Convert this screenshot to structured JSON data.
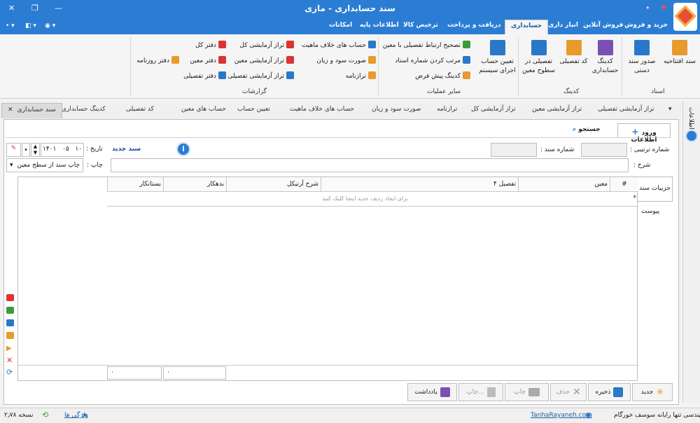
{
  "titlebar": {
    "title": "سند حسابداری - مازی"
  },
  "menu": {
    "items": [
      "خرید و فروش",
      "فروش آنلاین",
      "انبار داری",
      "حسابداری",
      "دریافت و پرداخت",
      "ترخیص کالا",
      "اطلاعات پایه",
      "امکانات"
    ],
    "active_index": 3
  },
  "ribbon": {
    "sanad_group": {
      "label": "اسناد",
      "open_doc": "سند افتتاحیه",
      "issue_manual": "صدور سند دستی"
    },
    "coding_group": {
      "label": "کدینگ",
      "coding_acc": "کدینگ حسابداری",
      "detail_code": "کد تفصیلی",
      "detail_levels": "تفصیلی در سطوح معین"
    },
    "ops_group": {
      "label": "سایر عملیات",
      "set_system_acc": "تعیین حساب اجزای سیستم",
      "fix_link": "تصحیح ارتباط تفصیلی با معین",
      "sort_numbers": "مرتب کردن شماره اسناد",
      "default_coding": "کدینگ پیش فرض"
    },
    "reports_group": {
      "label": "گزارشات",
      "wrong_nature": "حساب های خلاف ماهیت",
      "profit_loss": "صورت سود و زیان",
      "balance": "ترازنامه",
      "trial_total": "تراز آزمایشی کل",
      "trial_moin": "تراز آزمایشی معین",
      "trial_detail": "تراز آزمایشی تفصیلی",
      "ledger_total": "دفتر کل",
      "ledger_moin": "دفتر معین",
      "ledger_detail": "دفتر تفصیلی",
      "journal": "دفتر روزنامه"
    }
  },
  "tabs": [
    {
      "label": "تراز آزمایشی تفصیلی"
    },
    {
      "label": "تراز آزمایشی معین"
    },
    {
      "label": "تراز آزمایشی کل"
    },
    {
      "label": "ترازنامه"
    },
    {
      "label": "صورت سود و زیان"
    },
    {
      "label": "حساب های خلاف ماهیت"
    },
    {
      "label": "تعیین حساب"
    },
    {
      "label": "حساب های معین"
    },
    {
      "label": "کد تفصیلی"
    },
    {
      "label": "کدینگ حسابداری"
    },
    {
      "label": "سند حسابداری"
    }
  ],
  "side_panel": {
    "label": "اطلاعات"
  },
  "form": {
    "tab_entry": "ورود اطلاعات",
    "tab_search": "جستجو",
    "serial_label": "شماره ترتیبی :",
    "doc_no_label": "شماره سند :",
    "desc_label": "شرح :",
    "new_doc": "سند جدید",
    "date_label": "تاریخ :",
    "date_day": "۱۰",
    "date_month": "۰۵",
    "date_year": "۱۴۰۱",
    "print_label": "چاپ :",
    "print_option": "چاپ سند از سطح معین"
  },
  "grid": {
    "side_tabs": [
      "جزییات سند",
      "پیوست"
    ],
    "columns": [
      "#",
      "معین",
      "تفصیل ۴",
      "شرح آرتیکل",
      "بدهکار",
      "بستانکار"
    ],
    "empty_hint": "برای ایجاد ردیف جدید اینجا کلیک کنید",
    "total_debit": "۰",
    "total_credit": "۰"
  },
  "buttons": {
    "new": "جدید",
    "save": "ذخیره",
    "delete": "حذف",
    "print": "چاپ",
    "print_more": "چاپ...",
    "note": "یادداشت"
  },
  "statusbar": {
    "company": "شرکت مهندسی تنها رایانه سوسف خورگام",
    "website": "TanhaRayaneh.com",
    "features": "ویژگی ها",
    "version": "نسخه ۲٫۷۸"
  }
}
